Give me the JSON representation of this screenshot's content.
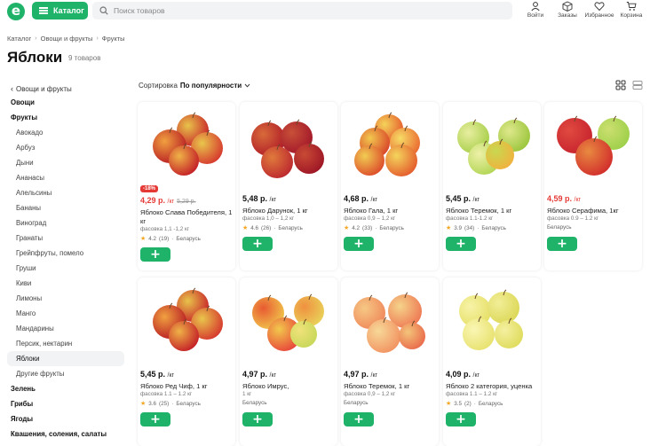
{
  "header": {
    "logo_letter": "e",
    "catalog_label": "Каталог",
    "search_placeholder": "Поиск товаров",
    "login_label": "Войти",
    "orders_label": "Заказы",
    "favorites_label": "Избранное",
    "cart_label": "Корзина"
  },
  "breadcrumb": [
    "Каталог",
    "Овощи и фрукты",
    "Фрукты"
  ],
  "page": {
    "title": "Яблоки",
    "count": "9 товаров"
  },
  "sort": {
    "label": "Сортировка",
    "value": "По популярности"
  },
  "sidebar": {
    "back": "Овощи и фрукты",
    "items": [
      {
        "label": "Овощи",
        "kind": "bold"
      },
      {
        "label": "Фрукты",
        "kind": "bold"
      },
      {
        "label": "Авокадо",
        "kind": "sub"
      },
      {
        "label": "Арбуз",
        "kind": "sub"
      },
      {
        "label": "Дыни",
        "kind": "sub"
      },
      {
        "label": "Ананасы",
        "kind": "sub"
      },
      {
        "label": "Апельсины",
        "kind": "sub"
      },
      {
        "label": "Бананы",
        "kind": "sub"
      },
      {
        "label": "Виноград",
        "kind": "sub"
      },
      {
        "label": "Гранаты",
        "kind": "sub"
      },
      {
        "label": "Грейпфруты, помело",
        "kind": "sub"
      },
      {
        "label": "Груши",
        "kind": "sub"
      },
      {
        "label": "Киви",
        "kind": "sub"
      },
      {
        "label": "Лимоны",
        "kind": "sub"
      },
      {
        "label": "Манго",
        "kind": "sub"
      },
      {
        "label": "Мандарины",
        "kind": "sub"
      },
      {
        "label": "Персик, нектарин",
        "kind": "sub"
      },
      {
        "label": "Яблоки",
        "kind": "sub active"
      },
      {
        "label": "Другие фрукты",
        "kind": "sub"
      },
      {
        "label": "Зелень",
        "kind": "bold"
      },
      {
        "label": "Грибы",
        "kind": "bold"
      },
      {
        "label": "Ягоды",
        "kind": "bold"
      },
      {
        "label": "Квашения, соления, салаты",
        "kind": "bold"
      }
    ]
  },
  "products": [
    {
      "price": "4,29 р.",
      "unit": "/кг",
      "old": "5,29 р.",
      "discount": "-18%",
      "name": "Яблоко Слава Победителя, 1 кг",
      "pack": "фасовка 1,1 -1,2 кг",
      "rating": "4.2",
      "reviews": "(19)",
      "origin": "Беларусь",
      "apple": "red"
    },
    {
      "price": "5,48 р.",
      "unit": "/кг",
      "name": "Яблоко Дарунок, 1 кг",
      "pack": "фасовка 1,0 – 1,2 кг",
      "rating": "4.6",
      "reviews": "(26)",
      "origin": "Беларусь",
      "apple": "darkred"
    },
    {
      "price": "4,68 р.",
      "unit": "/кг",
      "name": "Яблоко Гала, 1 кг",
      "pack": "фасовка 0,9 – 1,2 кг",
      "rating": "4.2",
      "reviews": "(33)",
      "origin": "Беларусь",
      "apple": "gala"
    },
    {
      "price": "5,45 р.",
      "unit": "/кг",
      "name": "Яблоко Теремок, 1 кг",
      "pack": "фасовка 1.1-1.2 кг",
      "rating": "3.9",
      "reviews": "(34)",
      "origin": "Беларусь",
      "apple": "green"
    },
    {
      "price": "4,59 р.",
      "unit": "/кг",
      "sale": true,
      "name": "Яблоко Серафима, 1кг",
      "pack": "фасовка 0.9 – 1.2 кг",
      "origin": "Беларусь",
      "apple": "mixed"
    },
    {
      "price": "5,45 р.",
      "unit": "/кг",
      "name": "Яблоко Ред Чиф, 1 кг",
      "pack": "фасовка 1.1 – 1.2 кг",
      "rating": "3.6",
      "reviews": "(25)",
      "origin": "Беларусь",
      "apple": "red"
    },
    {
      "price": "4,97 р.",
      "unit": "/кг",
      "name": "Яблоко Имрус,",
      "pack": "1 кг",
      "origin": "Беларусь",
      "apple": "yellowred"
    },
    {
      "price": "4,97 р.",
      "unit": "/кг",
      "name": "Яблоко Теремок, 1 кг",
      "pack": "фасовка 0,9 – 1,2 кг",
      "origin": "Беларусь",
      "apple": "peach"
    },
    {
      "price": "4,09 р.",
      "unit": "/кг",
      "name": "Яблоко 2 категория, уценка",
      "pack": "фасовка 1.1 – 1.2 кг",
      "rating": "3.5",
      "reviews": "(2)",
      "origin": "Беларусь",
      "apple": "yellow"
    }
  ],
  "colors": {
    "brand": "#1fb36a",
    "sale": "#e53935",
    "star": "#f5a623"
  }
}
